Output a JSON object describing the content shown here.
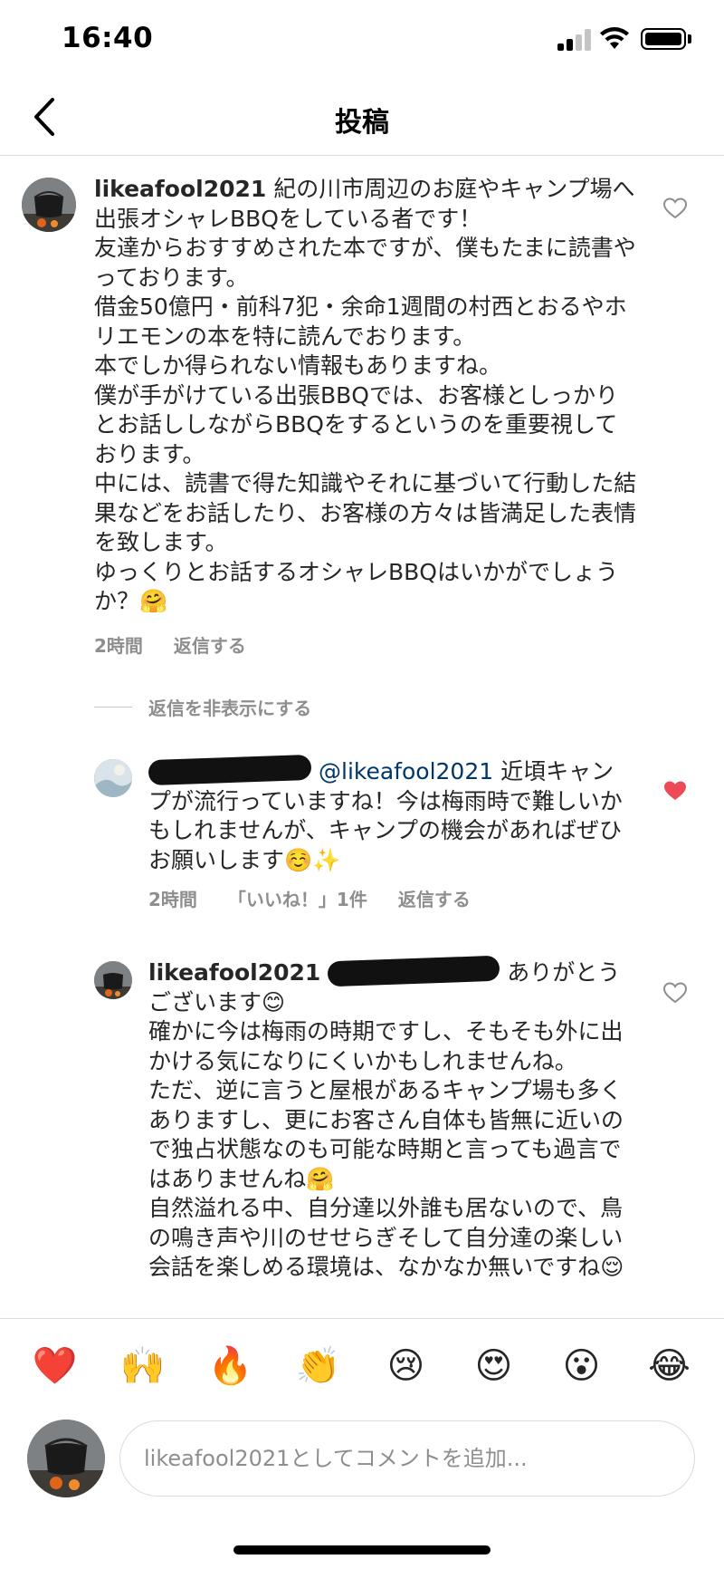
{
  "status_bar": {
    "time": "16:40"
  },
  "nav": {
    "title": "投稿"
  },
  "comments": [
    {
      "username": "likeafool2021",
      "paragraphs": [
        "紀の川市周辺のお庭やキャンプ場へ出張オシャレBBQをしている者です！",
        "友達からおすすめされた本ですが、僕もたまに読書やっております。",
        "借金50億円・前科7犯・余命1週間の村西とおるやホリエモンの本を特に読んでおります。",
        "本でしか得られない情報もありますね。",
        "僕が手がけている出張BBQでは、お客様としっかりとお話ししながらBBQをするというのを重要視しております。",
        "中には、読書で得た知識やそれに基づいて行動した結果などをお話したり、お客様の方々は皆満足した表情を致します。",
        "ゆっくりとお話するオシャレBBQはいかがでしょうか？🤗"
      ],
      "time": "2時間",
      "reply_label": "返信する",
      "liked": false
    },
    {
      "mention": "@likeafool2021",
      "paragraphs": [
        "近頃キャンプが流行っていますね！今は梅雨時で難しいかもしれませんが、キャンプの機会があればぜひお願いします☺️✨"
      ],
      "time": "2時間",
      "likes_label": "「いいね！」1件",
      "reply_label": "返信する",
      "liked": true
    },
    {
      "username": "likeafool2021",
      "paragraphs": [
        "ありがとうございます😊",
        "確かに今は梅雨の時期ですし、そもそも外に出かける気になりにくいかもしれませんね。",
        "ただ、逆に言うと屋根があるキャンプ場も多くありますし、更にお客さん自体も皆無に近いので独占状態なのも可能な時期と言っても過言ではありませんね🤗",
        "自然溢れる中、自分達以外誰も居ないので、鳥の鳴き声や川のせせらぎそして自分達の楽しい会話を楽しめる環境は、なかなか無いですね😌"
      ],
      "liked": false
    }
  ],
  "hide_replies_label": "返信を非表示にする",
  "emoji_bar": [
    "❤️",
    "🙌",
    "🔥",
    "👏",
    "😢",
    "😍",
    "😮",
    "😂"
  ],
  "composer": {
    "placeholder": "likeafool2021としてコメントを追加..."
  },
  "colors": {
    "like_active": "#ed4956",
    "muted": "#8e8e8e",
    "mention": "#00376b"
  }
}
